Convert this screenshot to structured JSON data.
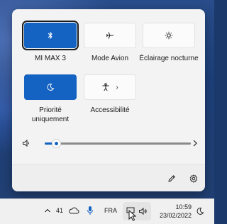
{
  "quick_settings": {
    "tiles": [
      {
        "label": "MI MAX 3",
        "icon": "bluetooth-icon",
        "active": true,
        "selected": true
      },
      {
        "label": "Mode Avion",
        "icon": "airplane-icon",
        "active": false
      },
      {
        "label": "Éclairage nocturne",
        "icon": "brightness-icon",
        "active": false
      },
      {
        "label": "Priorité uniquement",
        "icon": "moon-icon",
        "active": true
      },
      {
        "label": "Accessibilité",
        "icon": "accessibility-icon",
        "active": false
      }
    ],
    "volume": {
      "level": 0.08
    },
    "accent_color": "#1462c1"
  },
  "taskbar": {
    "temperature": "41",
    "language": "FRA",
    "time": "10:59",
    "date": "23/02/2022"
  }
}
